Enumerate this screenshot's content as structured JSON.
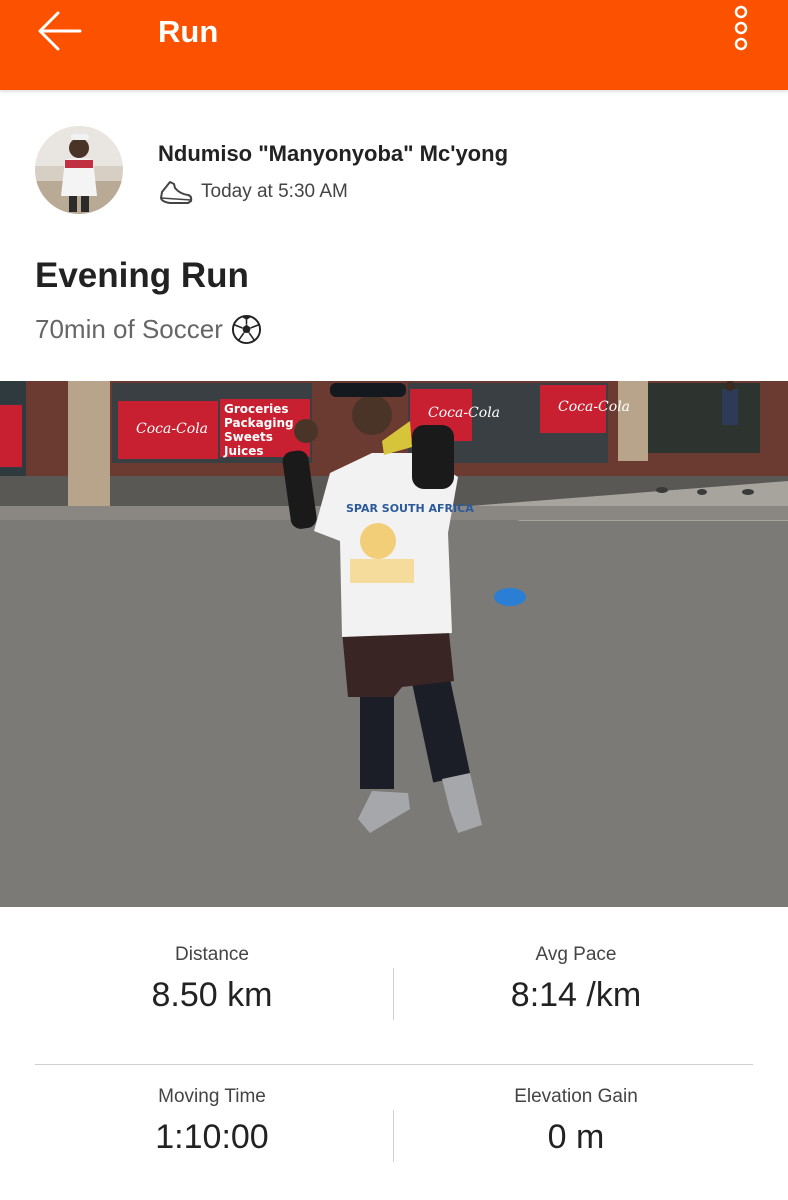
{
  "header": {
    "title": "Run",
    "back_icon": "arrow-left-icon",
    "menu_icon": "more-vertical-icon",
    "accent_color": "#fc5200"
  },
  "athlete": {
    "name": "Ndumiso \"Manyonyoba\" Mc'yong",
    "avatar": "athlete-avatar-photo",
    "activity_icon": "running-shoe-icon",
    "timestamp": "Today at 5:30 AM"
  },
  "activity": {
    "name": "Evening Run",
    "description": "70min of Soccer",
    "description_icon": "soccer-ball-icon"
  },
  "photo": {
    "sign_right": "Groceries Packaging Sweets Juices",
    "sign_brand": "Coca-Cola",
    "shirt_text": "SPAR SOUTH AFRICA"
  },
  "stats": [
    {
      "label": "Distance",
      "value": "8.50 km"
    },
    {
      "label": "Avg Pace",
      "value": "8:14 /km"
    },
    {
      "label": "Moving Time",
      "value": "1:10:00"
    },
    {
      "label": "Elevation Gain",
      "value": "0 m"
    }
  ]
}
